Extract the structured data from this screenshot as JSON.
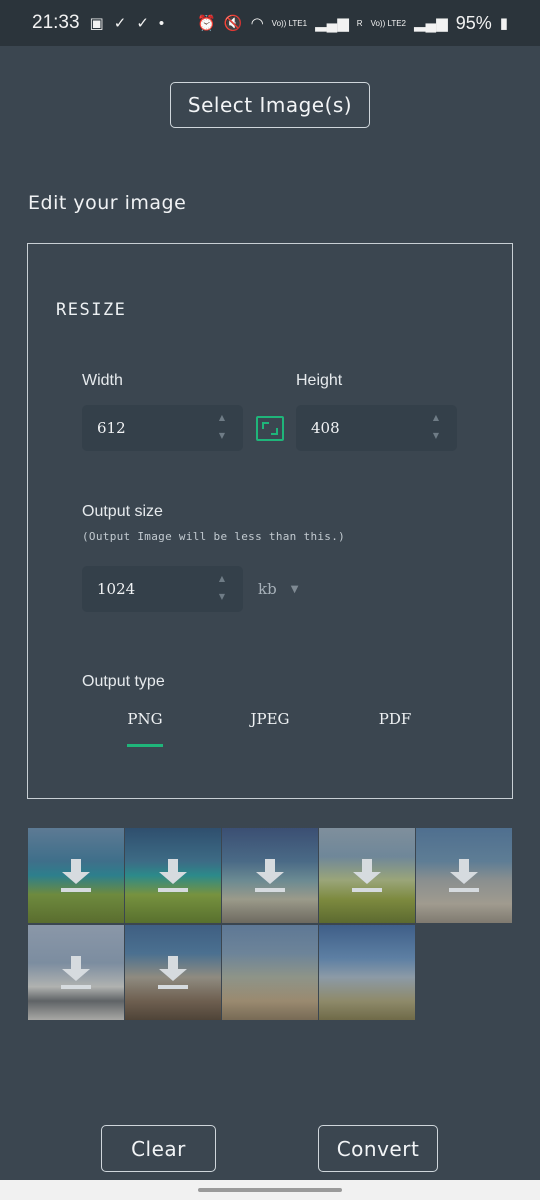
{
  "status_bar": {
    "time": "21:33",
    "notif_icons": [
      "image-icon",
      "check-icon",
      "check-icon",
      "dot-icon"
    ],
    "net_label_1": "Vo)) LTE1",
    "net_label_2": "Vo)) LTE2",
    "net_r": "R",
    "battery": "95%"
  },
  "select_button": "Select Image(s)",
  "edit": {
    "title": "Edit your image",
    "section": "RESIZE",
    "width_label": "Width",
    "width_value": "612",
    "height_label": "Height",
    "height_value": "408",
    "output_size_label": "Output size",
    "output_size_hint": "(Output Image will be less than this.)",
    "output_size_value": "1024",
    "unit": "kb",
    "output_type_label": "Output type",
    "types": [
      "PNG",
      "JPEG",
      "PDF"
    ],
    "selected_type": "PNG"
  },
  "thumbnails": [
    {
      "download_icon": true
    },
    {
      "download_icon": true
    },
    {
      "download_icon": true
    },
    {
      "download_icon": true
    },
    {
      "download_icon": true
    },
    {
      "download_icon": true
    },
    {
      "download_icon": true
    },
    {
      "download_icon": false
    },
    {
      "download_icon": false
    }
  ],
  "buttons": {
    "clear": "Clear",
    "convert": "Convert"
  },
  "colors": {
    "background": "#3b4650",
    "accent": "#1fb57a",
    "input_bg": "#34404a"
  }
}
